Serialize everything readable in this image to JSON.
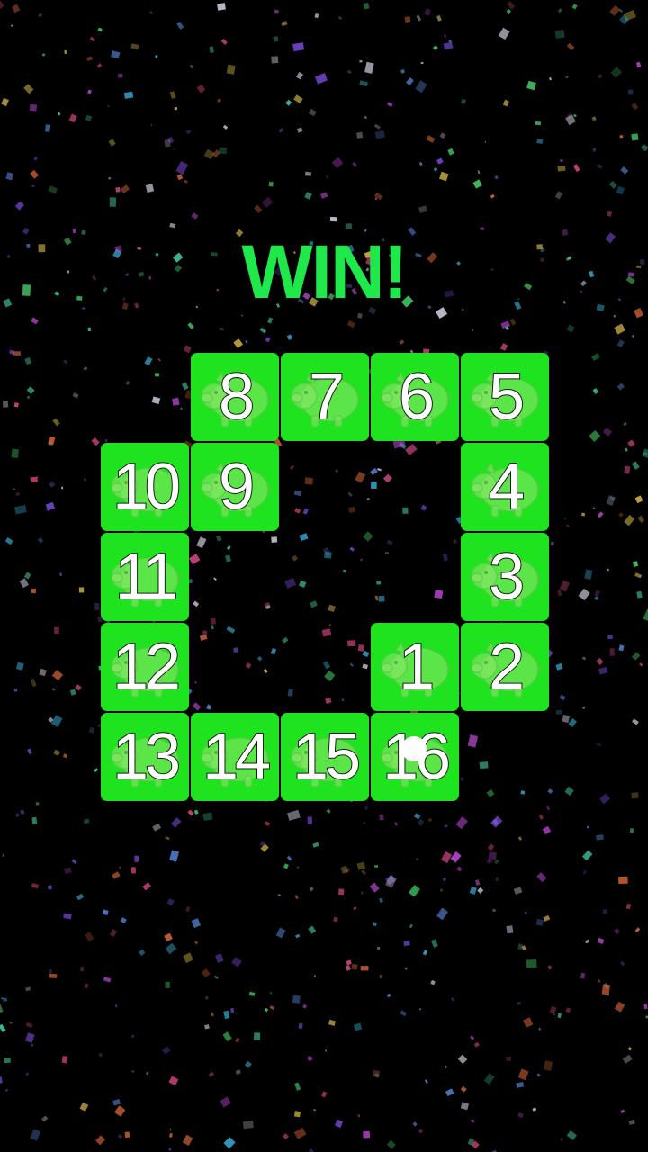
{
  "title": "WIN!",
  "colors": {
    "background": "#000000",
    "title": "#1ee84a",
    "tile": "#20e320",
    "tile_number": "#ffffff"
  },
  "tiles": [
    {
      "label": "1"
    },
    {
      "label": "2"
    },
    {
      "label": "3"
    },
    {
      "label": "4"
    },
    {
      "label": "5"
    },
    {
      "label": "6"
    },
    {
      "label": "7"
    },
    {
      "label": "8"
    },
    {
      "label": "9"
    },
    {
      "label": "10"
    },
    {
      "label": "11"
    },
    {
      "label": "12"
    },
    {
      "label": "13"
    },
    {
      "label": "14"
    },
    {
      "label": "15"
    },
    {
      "label": "16"
    }
  ],
  "tile_icon": "pig-icon"
}
